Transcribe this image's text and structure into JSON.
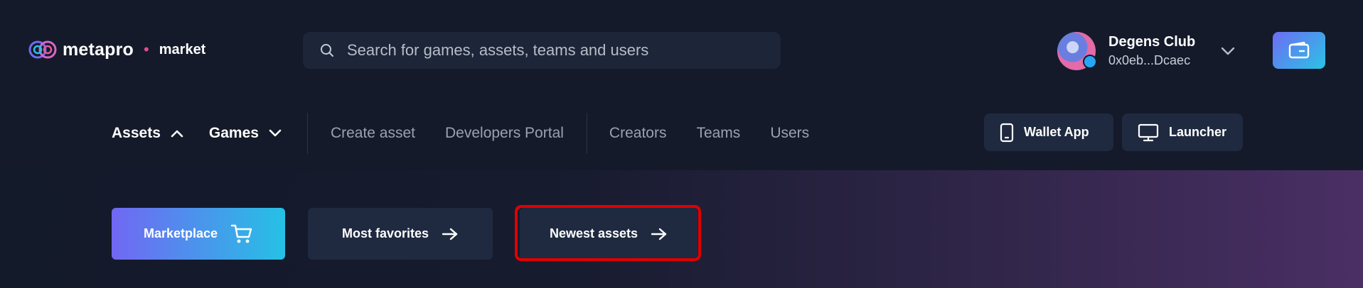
{
  "header": {
    "logo_text": "metapro",
    "logo_separator": "•",
    "logo_market": "market",
    "search": {
      "placeholder": "Search for games, assets, teams and users"
    },
    "user": {
      "name": "Degens Club",
      "address": "0x0eb...Dcaec"
    }
  },
  "nav": {
    "items": [
      {
        "label": "Assets",
        "state": "expanded"
      },
      {
        "label": "Games",
        "state": "collapsed"
      },
      {
        "label": "Create asset"
      },
      {
        "label": "Developers Portal"
      },
      {
        "label": "Creators"
      },
      {
        "label": "Teams"
      },
      {
        "label": "Users"
      }
    ],
    "wallet_app_label": "Wallet App",
    "launcher_label": "Launcher"
  },
  "hero": {
    "marketplace_label": "Marketplace",
    "most_favorites_label": "Most favorites",
    "newest_assets_label": "Newest assets",
    "highlighted": "Newest assets"
  },
  "colors": {
    "background": "#131a2a",
    "accent_gradient_start": "#6d6cf4",
    "accent_gradient_end": "#2ac3e5",
    "logo_dot": "#e84b8a",
    "highlight": "#e00000"
  }
}
